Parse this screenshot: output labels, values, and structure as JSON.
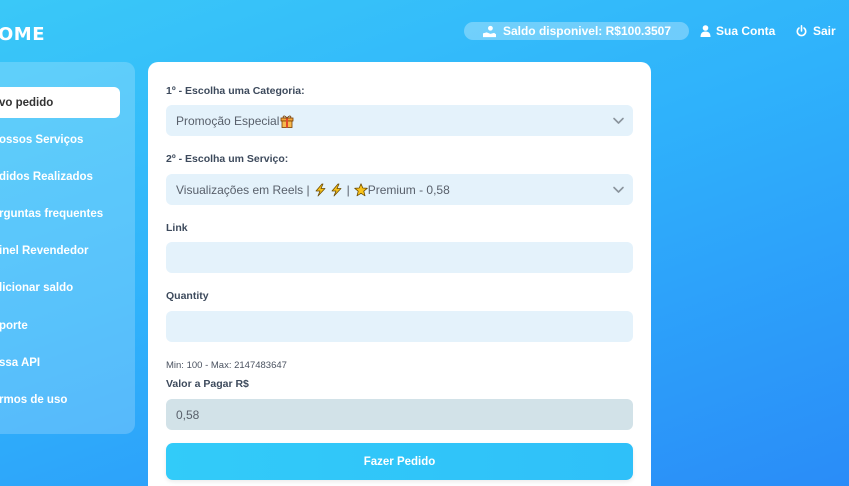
{
  "brand": {
    "logo_text": "OME"
  },
  "header": {
    "balance_label": "Saldo disponivel: R$100.3507",
    "account_label": "Sua Conta",
    "logout_label": "Sair"
  },
  "sidebar": {
    "items": [
      {
        "label": "vo pedido",
        "active": true
      },
      {
        "label": "ossos Serviços"
      },
      {
        "label": "didos Realizados"
      },
      {
        "label": "rguntas frequentes"
      },
      {
        "label": "inel Revendedor"
      },
      {
        "label": "licionar saldo"
      },
      {
        "label": "porte"
      },
      {
        "label": "ssa API"
      },
      {
        "label": "rmos de uso"
      }
    ]
  },
  "form": {
    "category": {
      "label": "1º - Escolha uma Categoria:",
      "value": "Promoção Especial"
    },
    "service": {
      "label": "2º - Escolha um Serviço:",
      "value_part1": "Visualizações em Reels |",
      "value_part2": "|",
      "value_part3": "Premium - 0,58"
    },
    "link": {
      "label": "Link",
      "value": ""
    },
    "quantity": {
      "label": "Quantity",
      "value": ""
    },
    "minmax": "Min: 100 - Max: 2147483647",
    "price": {
      "label": "Valor a Pagar R$",
      "value": "0,58"
    },
    "submit_label": "Fazer Pedido"
  },
  "colors": {
    "accent": "#32cbf9",
    "input_bg": "#e4f2fb",
    "disabled_bg": "#d2e2e8"
  },
  "icons": {
    "balance": "hand-coin-icon",
    "account": "user-icon",
    "logout": "power-icon",
    "category_emoji": "gift-icon",
    "service_emoji": "lightning-icon",
    "premium_emoji": "star-icon"
  }
}
